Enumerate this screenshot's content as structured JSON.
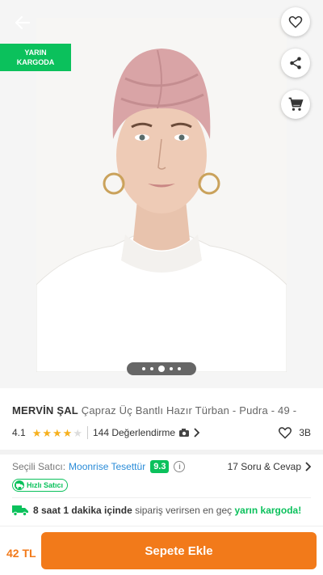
{
  "badge": {
    "line1": "YARIN",
    "line2": "KARGODA"
  },
  "gallery": {
    "dots": 5,
    "active_dot": 3
  },
  "product": {
    "brand": "MERVİN ŞAL",
    "name": "Çapraz Üç Bantlı Hazır Türban - Pudra - 49 -"
  },
  "rating": {
    "value": "4.1",
    "stars_filled": 4,
    "reviews_label": "144 Değerlendirme",
    "favorites": "3B"
  },
  "seller": {
    "label": "Seçili Satıcı:",
    "name": "Moonrise Tesettür",
    "score": "9.3",
    "qa_label": "17 Soru & Cevap",
    "fast_label": "Hızlı Satıcı"
  },
  "delivery": {
    "time": "8 saat 1 dakika içinde",
    "text": "sipariş verirsen en geç",
    "highlight": "yarın kargoda!"
  },
  "bottom": {
    "price": "42 TL",
    "cart_label": "Sepete Ekle"
  },
  "colors": {
    "accent": "#f27a1a",
    "green": "#0bc15c",
    "seller_link": "#2a8cd8",
    "star": "#f6b01e"
  }
}
